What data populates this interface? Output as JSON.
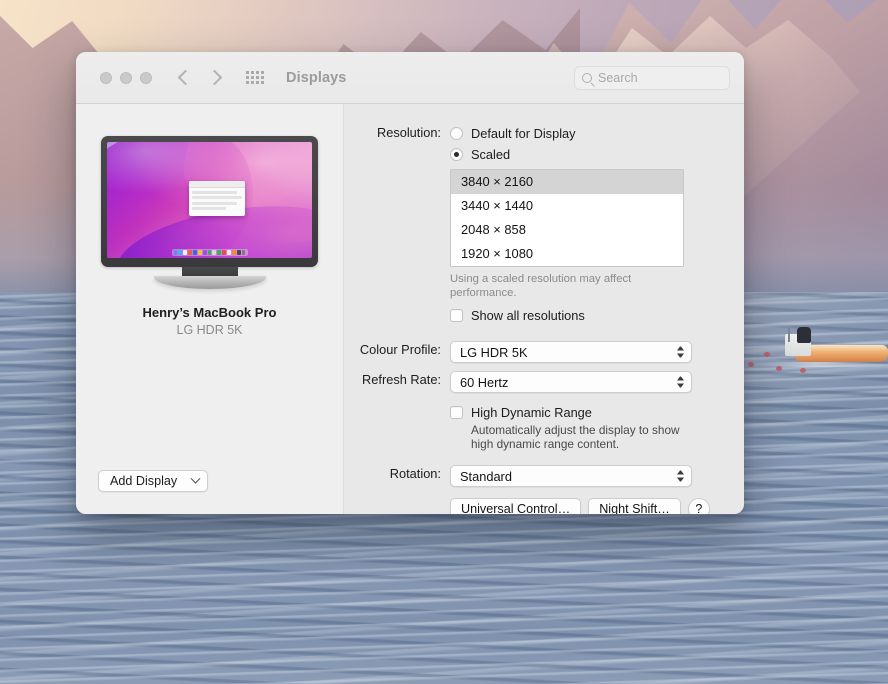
{
  "window": {
    "title": "Displays",
    "traffic_lights": [
      "close-button",
      "minimize-button",
      "zoom-button"
    ],
    "back_label": "Back",
    "forward_label": "Forward",
    "grid_label": "Show All",
    "search": {
      "placeholder": "Search",
      "value": ""
    }
  },
  "preview": {
    "display_name": "Henry’s MacBook Pro",
    "display_sub": "LG HDR 5K",
    "add_display_label": "Add Display"
  },
  "settings": {
    "resolution": {
      "label": "Resolution:",
      "options": [
        {
          "label": "Default for Display",
          "selected": false
        },
        {
          "label": "Scaled",
          "selected": true
        }
      ],
      "list": [
        {
          "label": "3840 × 2160",
          "selected": true
        },
        {
          "label": "3440 × 1440",
          "selected": false
        },
        {
          "label": "2048 × 858",
          "selected": false
        },
        {
          "label": "1920 × 1080",
          "selected": false
        }
      ],
      "hint": "Using a scaled resolution may affect performance.",
      "show_all": {
        "label": "Show all resolutions",
        "checked": false
      }
    },
    "colour_profile": {
      "label": "Colour Profile:",
      "value": "LG HDR 5K"
    },
    "refresh_rate": {
      "label": "Refresh Rate:",
      "value": "60 Hertz"
    },
    "hdr": {
      "label": "High Dynamic Range",
      "checked": false,
      "description": "Automatically adjust the display to show high dynamic range content."
    },
    "rotation": {
      "label": "Rotation:",
      "value": "Standard"
    },
    "buttons": {
      "universal_control": "Universal Control…",
      "night_shift": "Night Shift…",
      "help": "?"
    }
  },
  "colors": {
    "window_chrome": "#ececec",
    "left_pane": "#f0efef",
    "right_pane": "#e9e8e8",
    "selection": "#d5d4d4",
    "title_text": "#9d9b9b"
  }
}
